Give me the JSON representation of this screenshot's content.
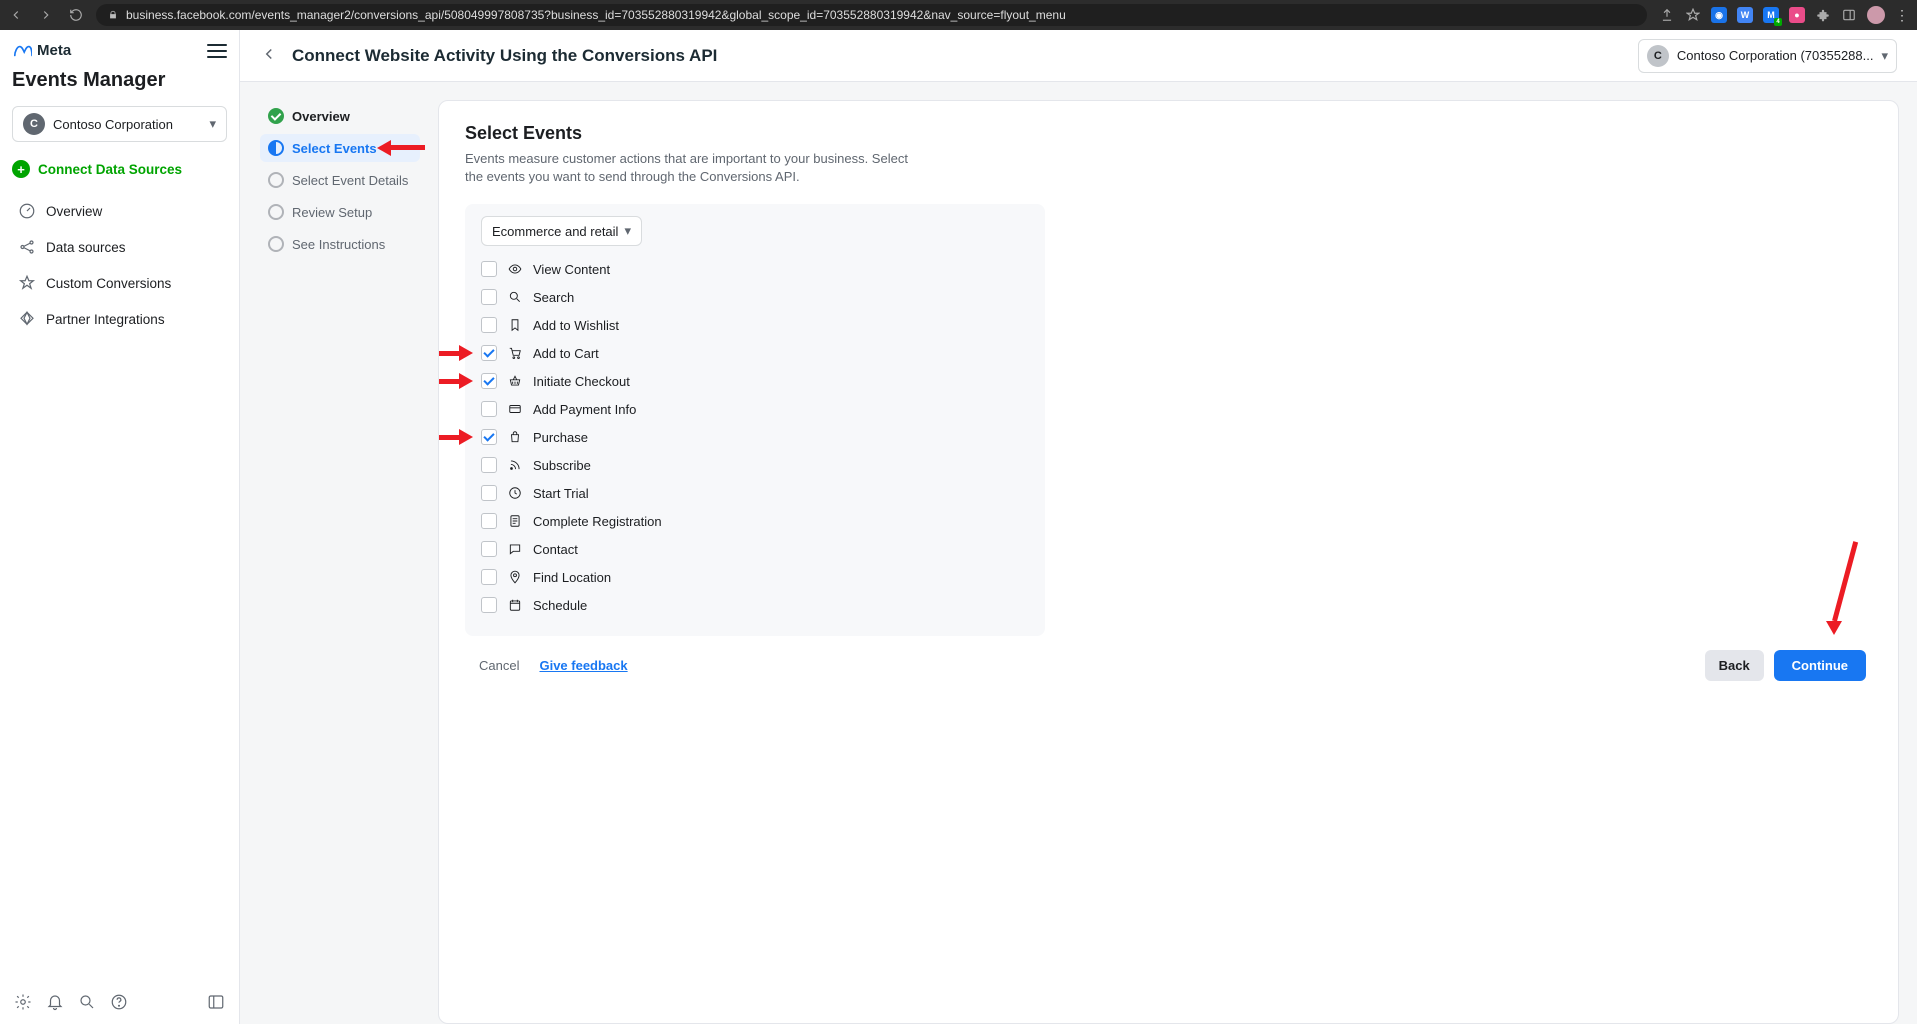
{
  "browser": {
    "url": "business.facebook.com/events_manager2/conversions_api/508049997808735?business_id=703552880319942&global_scope_id=703552880319942&nav_source=flyout_menu"
  },
  "sidebar": {
    "brand": "Meta",
    "title": "Events Manager",
    "company": {
      "initial": "C",
      "name": "Contoso Corporation"
    },
    "connect_label": "Connect Data Sources",
    "nav": [
      {
        "label": "Overview"
      },
      {
        "label": "Data sources"
      },
      {
        "label": "Custom Conversions"
      },
      {
        "label": "Partner Integrations"
      }
    ]
  },
  "header": {
    "title": "Connect Website Activity Using the Conversions API",
    "business_switcher": {
      "initial": "C",
      "label": "Contoso Corporation (70355288..."
    }
  },
  "steps": [
    {
      "label": "Overview",
      "state": "done"
    },
    {
      "label": "Select Events",
      "state": "active"
    },
    {
      "label": "Select Event Details",
      "state": "todo"
    },
    {
      "label": "Review Setup",
      "state": "todo"
    },
    {
      "label": "See Instructions",
      "state": "todo"
    }
  ],
  "content": {
    "title": "Select Events",
    "description": "Events measure customer actions that are important to your business. Select the events you want to send through the Conversions API.",
    "category": "Ecommerce and retail",
    "events": [
      {
        "label": "View Content",
        "checked": false,
        "icon": "eye"
      },
      {
        "label": "Search",
        "checked": false,
        "icon": "search"
      },
      {
        "label": "Add to Wishlist",
        "checked": false,
        "icon": "bookmark"
      },
      {
        "label": "Add to Cart",
        "checked": true,
        "icon": "cart",
        "annotated": true
      },
      {
        "label": "Initiate Checkout",
        "checked": true,
        "icon": "basket",
        "annotated": true
      },
      {
        "label": "Add Payment Info",
        "checked": false,
        "icon": "card"
      },
      {
        "label": "Purchase",
        "checked": true,
        "icon": "bag",
        "annotated": true
      },
      {
        "label": "Subscribe",
        "checked": false,
        "icon": "rss"
      },
      {
        "label": "Start Trial",
        "checked": false,
        "icon": "clock"
      },
      {
        "label": "Complete Registration",
        "checked": false,
        "icon": "form"
      },
      {
        "label": "Contact",
        "checked": false,
        "icon": "chat"
      },
      {
        "label": "Find Location",
        "checked": false,
        "icon": "pin"
      },
      {
        "label": "Schedule",
        "checked": false,
        "icon": "calendar"
      }
    ]
  },
  "footer": {
    "cancel": "Cancel",
    "feedback": "Give feedback",
    "back": "Back",
    "continue": "Continue"
  }
}
